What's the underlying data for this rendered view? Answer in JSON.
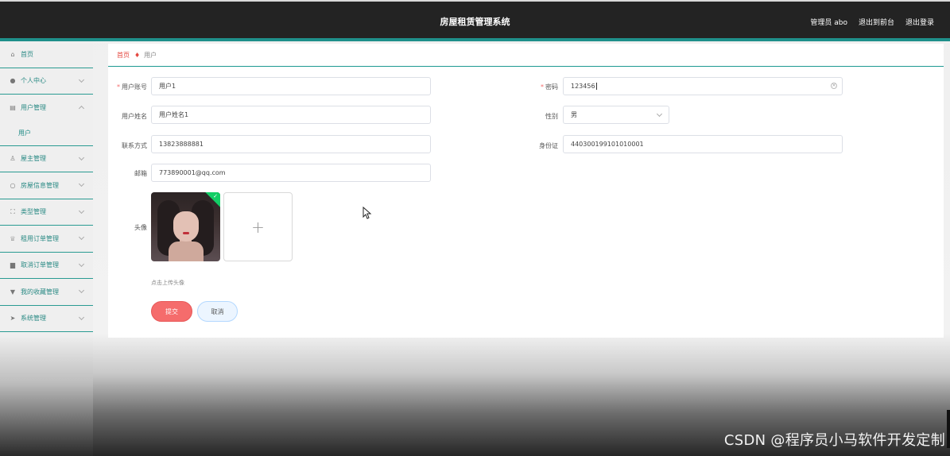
{
  "header": {
    "title": "房屋租赁管理系统",
    "user_label": "管理员 abo",
    "front_link": "退出到前台",
    "logout_link": "退出登录"
  },
  "sidebar": {
    "items": [
      {
        "label": "首页",
        "icon": "home-icon",
        "expandable": false
      },
      {
        "label": "个人中心",
        "icon": "user-icon",
        "expandable": true
      },
      {
        "label": "用户管理",
        "icon": "doc-icon",
        "expandable": true,
        "expanded": true
      },
      {
        "label": "用户",
        "icon": "",
        "sub": true
      },
      {
        "label": "屋主管理",
        "icon": "mic-icon",
        "expandable": true
      },
      {
        "label": "房屋信息管理",
        "icon": "power-icon",
        "expandable": true
      },
      {
        "label": "类型管理",
        "icon": "frame-icon",
        "expandable": true
      },
      {
        "label": "租用订单管理",
        "icon": "badge-icon",
        "expandable": true
      },
      {
        "label": "取消订单管理",
        "icon": "briefcase-icon",
        "expandable": true
      },
      {
        "label": "我的收藏管理",
        "icon": "pin-icon",
        "expandable": true
      },
      {
        "label": "系统管理",
        "icon": "send-icon",
        "expandable": true
      }
    ]
  },
  "breadcrumb": {
    "home": "首页",
    "current": "用户"
  },
  "form": {
    "account": {
      "label": "用户账号",
      "value": "用户1",
      "required": true
    },
    "password": {
      "label": "密码",
      "value": "123456",
      "required": true
    },
    "name": {
      "label": "用户姓名",
      "value": "用户姓名1"
    },
    "gender": {
      "label": "性别",
      "value": "男"
    },
    "phone": {
      "label": "联系方式",
      "value": "13823888881"
    },
    "id_card": {
      "label": "身份证",
      "value": "440300199101010001"
    },
    "email": {
      "label": "邮箱",
      "value": "773890001@qq.com"
    },
    "avatar": {
      "label": "头像",
      "hint": "点击上传头像",
      "upload_symbol": "+"
    }
  },
  "buttons": {
    "submit": "提交",
    "cancel": "取消"
  },
  "watermark": "CSDN @程序员小马软件开发定制",
  "colors": {
    "accent": "#1e8f8a",
    "danger": "#f56c6c",
    "success": "#13ce66"
  }
}
